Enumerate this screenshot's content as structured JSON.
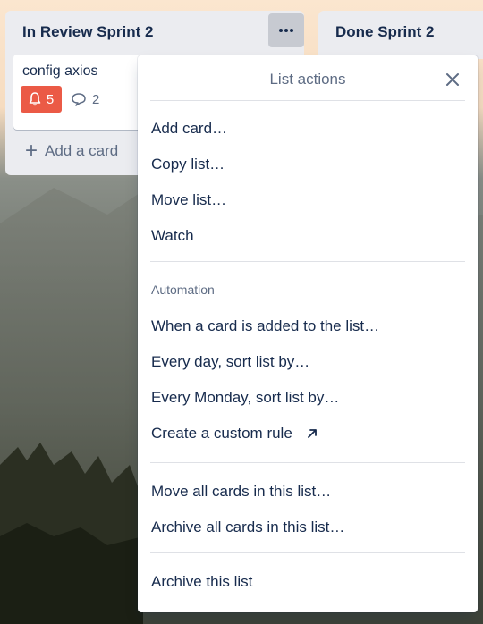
{
  "board": {
    "list_left": {
      "title": "In Review Sprint 2",
      "card": {
        "title": "config axios",
        "notification_count": "5",
        "comment_count": "2"
      },
      "add_card_label": "Add a card"
    },
    "list_right": {
      "title": "Done Sprint 2"
    }
  },
  "popover": {
    "title": "List actions",
    "group1": [
      "Add card…",
      "Copy list…",
      "Move list…",
      "Watch"
    ],
    "automation_label": "Automation",
    "group2": [
      "When a card is added to the list…",
      "Every day, sort list by…",
      "Every Monday, sort list by…",
      "Create a custom rule"
    ],
    "group3": [
      "Move all cards in this list…",
      "Archive all cards in this list…"
    ],
    "group4": [
      "Archive this list"
    ]
  },
  "colors": {
    "list_bg": "#ebecf0",
    "alert_badge": "#eb5a46",
    "text": "#172b4d",
    "muted": "#5e6c84"
  },
  "icons": [
    "more-icon",
    "bell-icon",
    "comment-icon",
    "plus-icon",
    "close-icon",
    "external-link-icon"
  ]
}
